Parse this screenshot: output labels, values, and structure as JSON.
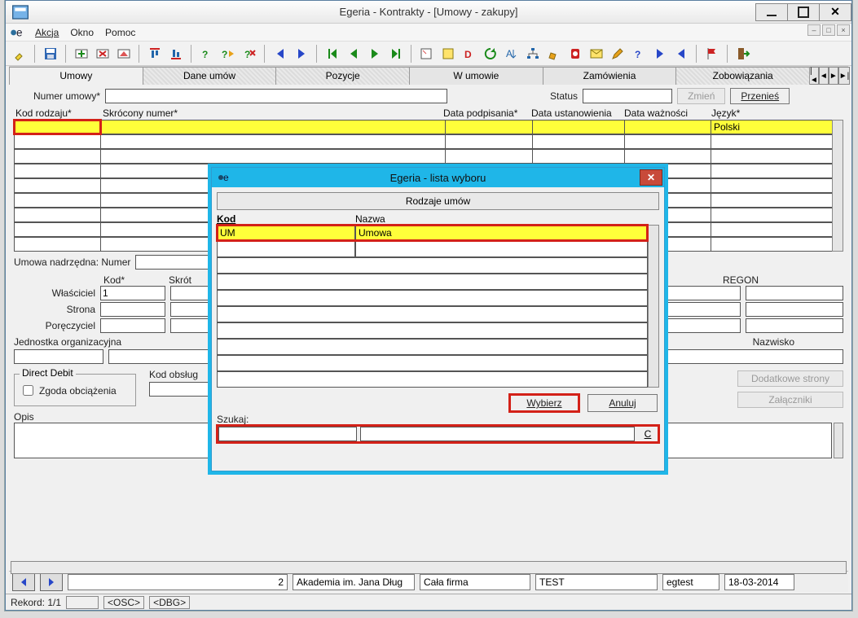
{
  "window": {
    "title": "Egeria - Kontrakty - [Umowy - zakupy]"
  },
  "menu": {
    "akcja": "Akcja",
    "okno": "Okno",
    "pomoc": "Pomoc"
  },
  "tabs": {
    "umowy": "Umowy",
    "dane": "Dane umów",
    "pozycje": "Pozycje",
    "wumowie": "W umowie",
    "zamowienia": "Zamówienia",
    "zobowiazania": "Zobowiązania"
  },
  "labels": {
    "numer_umowy": "Numer umowy*",
    "status": "Status",
    "zmien": "Zmień",
    "przenies": "Przenieś",
    "kod_rodzaju": "Kod rodzaju*",
    "skrocony_numer": "Skrócony numer*",
    "data_podpisania": "Data podpisania*",
    "data_ustanowienia": "Data ustanowienia",
    "data_waznosci": "Data ważności",
    "jezyk": "Język*",
    "umowa_nad": "Umowa nadrzędna: Numer",
    "kod": "Kod*",
    "skrot": "Skrót",
    "regon": "REGON",
    "wlasciciel": "Właściciel",
    "strona": "Strona",
    "poreczyciel": "Poręczyciel",
    "jednostka": "Jednostka organizacyjna",
    "nazwisko": "Nazwisko",
    "direct_debit": "Direct Debit",
    "zgoda": "Zgoda obciążenia",
    "kod_obslug": "Kod obsług",
    "opis": "Opis",
    "dodatkowe": "Dodatkowe strony",
    "zalaczniki": "Załączniki"
  },
  "grid": {
    "jezyk_value": "Polski"
  },
  "owner_value": "1",
  "modal": {
    "title": "Egeria - lista wyboru",
    "header": "Rodzaje umów",
    "col_kod": "Kod",
    "col_nazwa": "Nazwa",
    "row0_kod": "UM",
    "row0_nazwa": "Umowa",
    "wybierz": "Wybierz",
    "anuluj": "Anuluj",
    "szukaj": "Szukaj:",
    "c": "C"
  },
  "status": {
    "num": "2",
    "org": "Akademia im. Jana Dług",
    "firma": "Cała firma",
    "env": "TEST",
    "user": "egtest",
    "date": "18-03-2014"
  },
  "lowstat": {
    "rekord": "Rekord: 1/1",
    "osc": "<OSC>",
    "dbg": "<DBG>"
  }
}
